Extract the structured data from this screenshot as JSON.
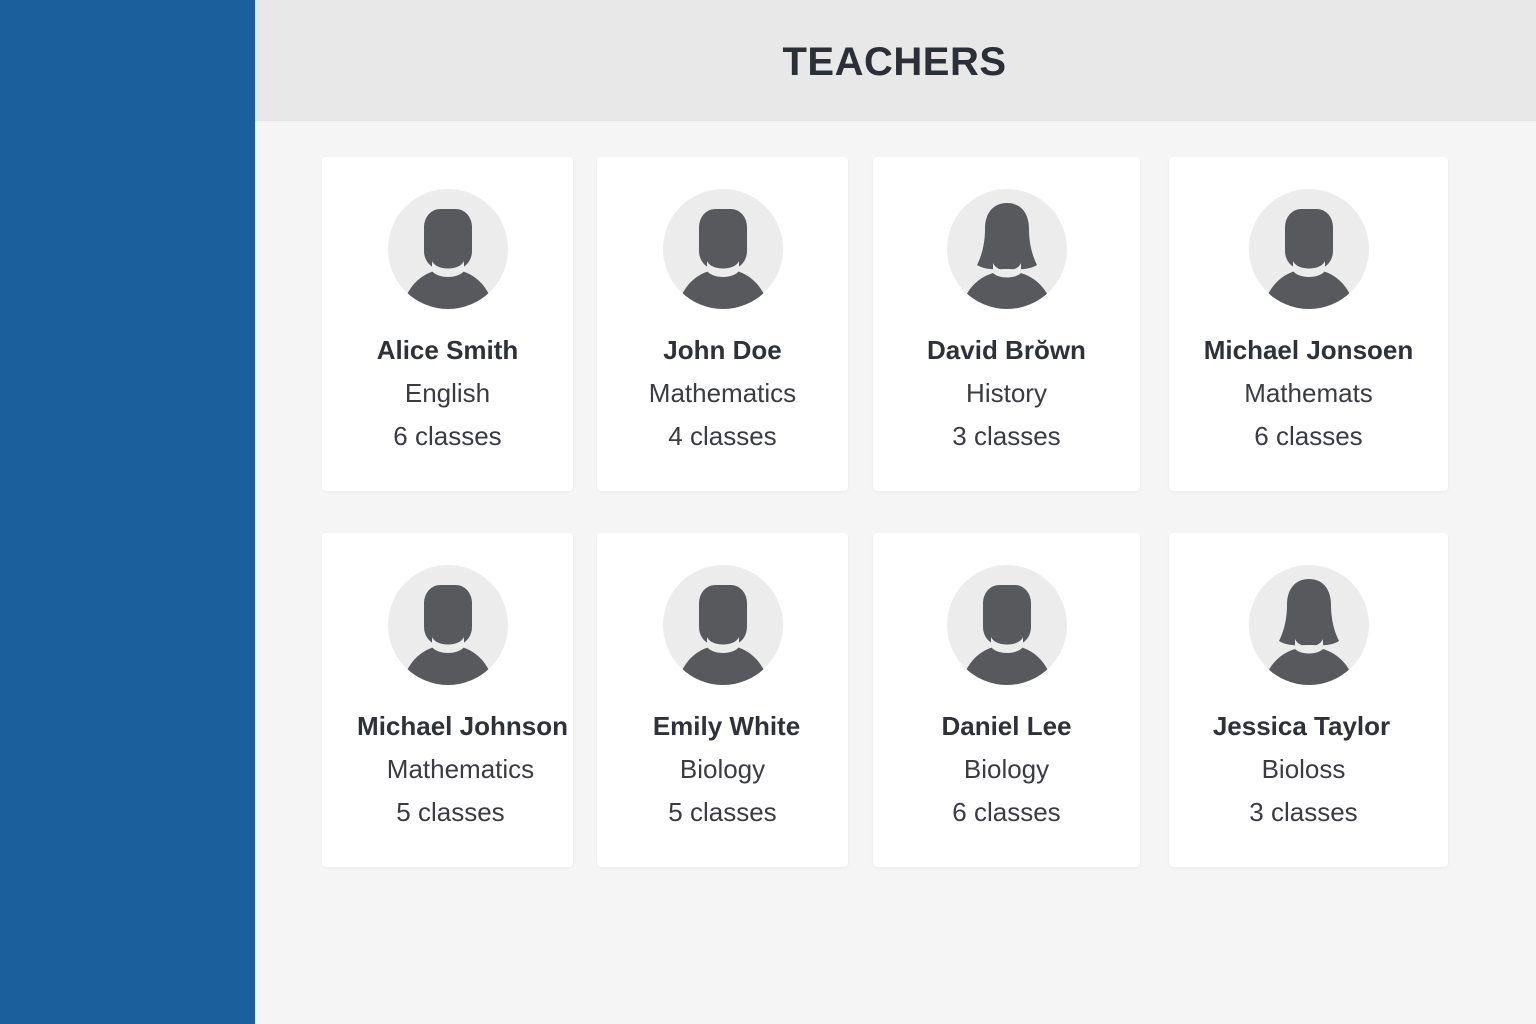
{
  "colors": {
    "sidebar": "#1b609c",
    "header_bg": "#e8e8e8",
    "main_bg": "#f5f5f5",
    "card_bg": "#ffffff",
    "avatar_bg": "#ececec",
    "avatar_icon": "#58595c"
  },
  "header": {
    "title": "TEACHERS"
  },
  "teachers": [
    {
      "name": "Alice Smith",
      "subject": "English",
      "classes": "6 classes",
      "avatar_icon": "user-male-icon"
    },
    {
      "name": "John Doe",
      "subject": "Mathematics",
      "classes": "4 classes",
      "avatar_icon": "user-male-icon"
    },
    {
      "name": "David Brŏwn",
      "subject": "History",
      "classes": "3 classes",
      "avatar_icon": "user-female-icon"
    },
    {
      "name": "Michael Jonsoen",
      "subject": "Mathemats",
      "classes": "6 classes",
      "avatar_icon": "user-male-icon"
    },
    {
      "name": "Michael Johnson",
      "subject": "Mathematics",
      "classes": "5 classes",
      "avatar_icon": "user-male-icon"
    },
    {
      "name": "Emily White",
      "subject": "Biology",
      "classes": "5 classes",
      "avatar_icon": "user-male-icon"
    },
    {
      "name": "Daniel Lee",
      "subject": "Biology",
      "classes": "6 classes",
      "avatar_icon": "user-male-icon"
    },
    {
      "name": "Jessica Taylor",
      "subject": "Bioloss",
      "classes": "3 classes",
      "avatar_icon": "user-female-icon"
    }
  ]
}
